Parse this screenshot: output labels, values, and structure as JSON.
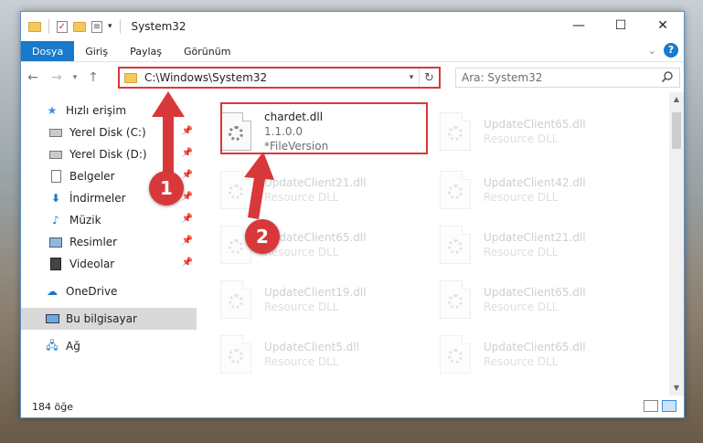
{
  "window": {
    "title": "System32",
    "controls": {
      "minimize": "—",
      "maximize": "☐",
      "close": "✕"
    }
  },
  "ribbon": {
    "tabs": [
      {
        "label": "Dosya",
        "active": true
      },
      {
        "label": "Giriş"
      },
      {
        "label": "Paylaş"
      },
      {
        "label": "Görünüm"
      }
    ],
    "help": "?"
  },
  "navigation": {
    "back": "←",
    "forward": "→",
    "recent": "▾",
    "up": "↑",
    "address": "C:\\Windows\\System32",
    "search_placeholder": "Ara: System32"
  },
  "sidebar": {
    "quick_access": "Hızlı erişim",
    "items": [
      {
        "label": "Yerel Disk (C:)",
        "icon": "drive-icon"
      },
      {
        "label": "Yerel Disk (D:)",
        "icon": "drive-icon"
      },
      {
        "label": "Belgeler",
        "icon": "documents-icon"
      },
      {
        "label": "İndirmeler",
        "icon": "downloads-icon"
      },
      {
        "label": "Müzik",
        "icon": "music-icon"
      },
      {
        "label": "Resimler",
        "icon": "pictures-icon"
      },
      {
        "label": "Videolar",
        "icon": "videos-icon"
      }
    ],
    "onedrive": "OneDrive",
    "this_pc": "Bu bilgisayar",
    "network": "Ağ"
  },
  "files": {
    "highlighted": {
      "name": "chardet.dll",
      "version": "1.1.0.0",
      "description": "*FileVersion"
    },
    "left_column": [
      {
        "name": "UpdateClient21.dll",
        "type": "Resource DLL"
      },
      {
        "name": "UpdateClient65.dll",
        "type": "Resource DLL"
      },
      {
        "name": "UpdateClient19.dll",
        "type": "Resource DLL"
      },
      {
        "name": "UpdateClient5.dll",
        "type": "Resource DLL"
      }
    ],
    "right_column": [
      {
        "name": "UpdateClient65.dll",
        "type": "Resource DLL"
      },
      {
        "name": "UpdateClient42.dll",
        "type": "Resource DLL"
      },
      {
        "name": "UpdateClient21.dll",
        "type": "Resource DLL"
      },
      {
        "name": "UpdateClient65.dll",
        "type": "Resource DLL"
      },
      {
        "name": "UpdateClient65.dll",
        "type": "Resource DLL"
      }
    ]
  },
  "status": {
    "count": "184 öğe"
  },
  "callouts": {
    "one": "1",
    "two": "2"
  },
  "colors": {
    "accent": "#1979ca",
    "highlight": "#d9383a"
  }
}
